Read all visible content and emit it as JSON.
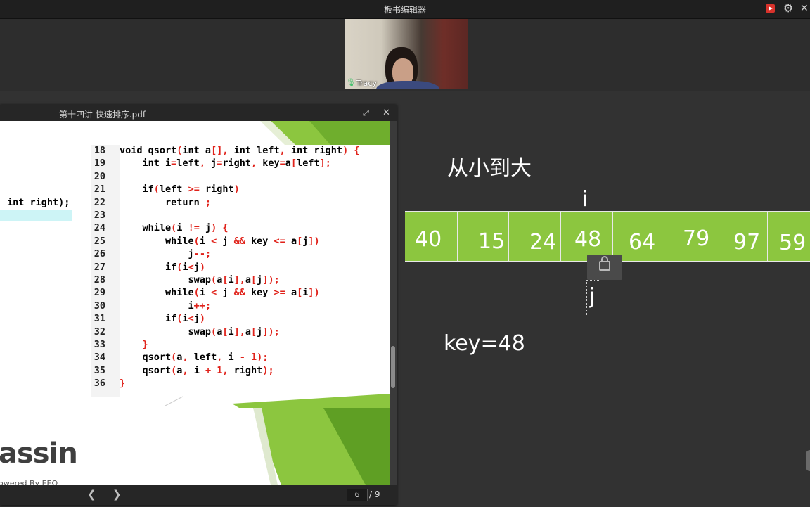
{
  "app": {
    "title": "板书编辑器",
    "icons": [
      "record-icon",
      "gear-icon",
      "close-icon"
    ]
  },
  "video": {
    "name": "Tracy"
  },
  "pdf": {
    "title": "第十四讲 快速排序.pdf",
    "controls": [
      "minimize",
      "maximize",
      "close"
    ],
    "page_current": "6",
    "page_total": "/ 9",
    "left_code": "int right);",
    "code": [
      {
        "n": "18",
        "t": "void qsort(int a[], int left, int right) {"
      },
      {
        "n": "19",
        "t": "    int i=left, j=right, key=a[left];"
      },
      {
        "n": "20",
        "t": ""
      },
      {
        "n": "21",
        "t": "    if(left >= right)"
      },
      {
        "n": "22",
        "t": "        return ;"
      },
      {
        "n": "23",
        "t": ""
      },
      {
        "n": "24",
        "t": "    while(i != j) {"
      },
      {
        "n": "25",
        "t": "        while(i < j && key <= a[j])"
      },
      {
        "n": "26",
        "t": "            j--;"
      },
      {
        "n": "27",
        "t": "        if(i<j)"
      },
      {
        "n": "28",
        "t": "            swap(a[i],a[j]);"
      },
      {
        "n": "29",
        "t": "        while(i < j && key >= a[i])"
      },
      {
        "n": "30",
        "t": "            i++;"
      },
      {
        "n": "31",
        "t": "        if(i<j)"
      },
      {
        "n": "32",
        "t": "            swap(a[i],a[j]);"
      },
      {
        "n": "33",
        "t": "    }"
      },
      {
        "n": "34",
        "t": "    qsort(a, left, i - 1);"
      },
      {
        "n": "35",
        "t": "    qsort(a, i + 1, right);"
      },
      {
        "n": "36",
        "t": "}"
      }
    ],
    "logo_text": "assin",
    "logo_sub": "owered By EEO"
  },
  "board": {
    "heading": "从小到大",
    "i_label": "i",
    "j_label": "j",
    "key_label": "key=48",
    "array": [
      "40",
      "15",
      "24",
      "48",
      "64",
      "79",
      "97",
      "59"
    ],
    "accent": "#8cc63f"
  }
}
